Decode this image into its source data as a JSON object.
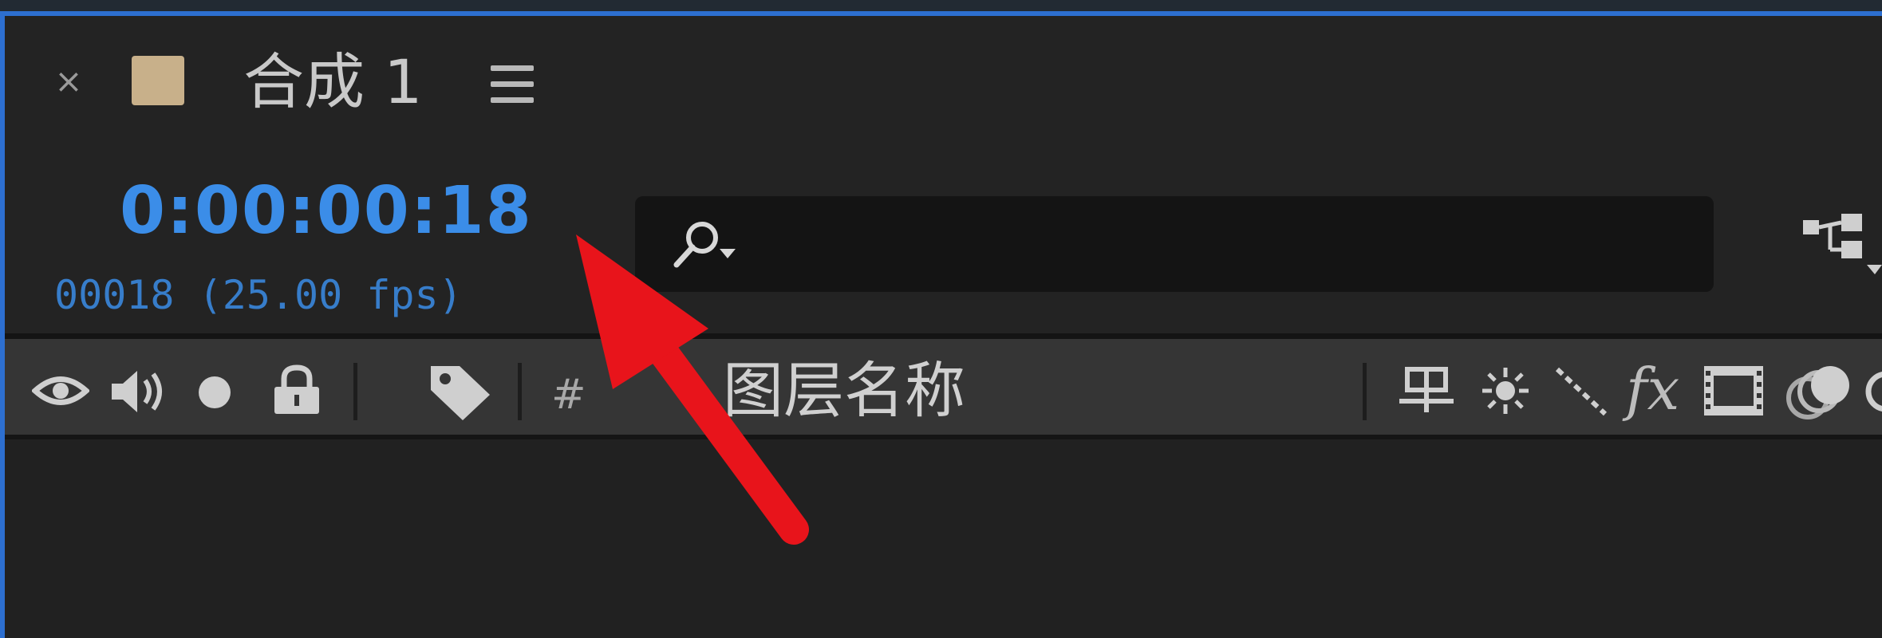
{
  "colors": {
    "accent": "#2d6fd0",
    "timecode": "#3b8de8",
    "comp_swatch": "#c8b08a",
    "annotation_arrow": "#e8141b"
  },
  "tab": {
    "close_glyph": "×",
    "title": "合成 1",
    "menu_icon": "hamburger-menu-icon"
  },
  "time": {
    "timecode": "0:00:00:18",
    "frame_info": "00018 (25.00 fps)"
  },
  "search": {
    "value": "",
    "icon": "search-icon"
  },
  "toolbar": {
    "flowchart_icon": "composition-flowchart-icon"
  },
  "columns": {
    "video_icon": "eye-icon",
    "audio_icon": "speaker-icon",
    "solo_icon": "solo-dot-icon",
    "lock_icon": "lock-icon",
    "label_icon": "label-tag-icon",
    "number_header": "#",
    "layer_name_header": "图层名称",
    "switches": [
      "shy-icon",
      "collapse-transform-icon",
      "quality-icon",
      "fx-icon",
      "frame-blending-icon",
      "motion-blur-icon",
      "adjustment-layer-icon"
    ],
    "fx_label": "fx"
  },
  "annotation": {
    "arrow_icon": "red-arrow-icon"
  }
}
